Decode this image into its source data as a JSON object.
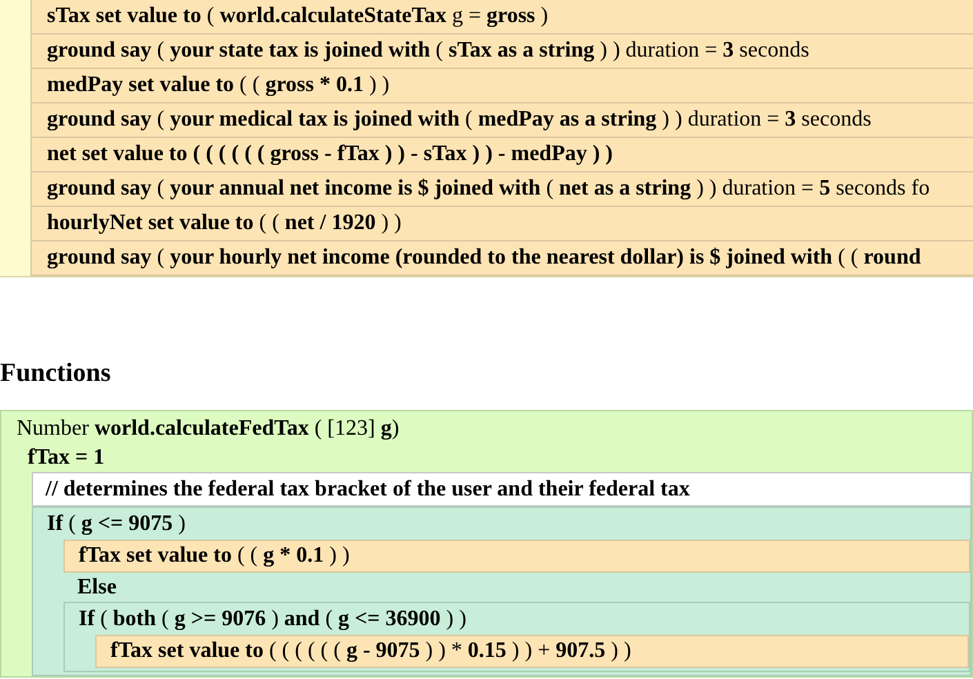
{
  "main_block": {
    "lines": [
      "**sTax set value to** ( **world.calculateStateTax** g = **gross** )",
      "**ground say** ( **your state tax is joined with** ( **sTax as a string** ) ) duration = **3** seconds",
      "**medPay set value to** ( ( **gross * 0.1** ) )",
      "**ground say** ( **your medical tax is joined with** ( **medPay as a string** ) ) duration = **3** seconds",
      "**net set value to ( ( ( ( ( ( gross - fTax ) ) - sTax ) ) - medPay ) )**",
      "**ground say** ( **your annual net income is $ joined with** ( **net as a string** ) ) duration = **5** seconds fo",
      "**hourlyNet set value to** ( ( **net / 1920** ) )",
      "**ground say** ( **your hourly net income (rounded to the nearest dollar) is $ joined with** ( ( **round**"
    ]
  },
  "functions": {
    "heading": "Functions",
    "function": {
      "signature": "Number **world.calculateFedTax** ( [123] **g**)",
      "children": [
        {
          "kind": "text",
          "text": "**fTax = 1**"
        },
        {
          "kind": "comment",
          "text": "**// determines the federal tax bracket of the user and their federal tax**"
        },
        {
          "kind": "if",
          "text": "**If** ( **g <= 9075** )",
          "children": [
            {
              "kind": "statement",
              "text": "**fTax set value to** ( ( **g * 0.1** ) )"
            },
            {
              "kind": "text",
              "text": "**Else**"
            },
            {
              "kind": "if",
              "text": "**If** ( **both** ( **g >= 9076** ) **and** ( **g <= 36900** ) )",
              "children": [
                {
                  "kind": "statement",
                  "text": "**fTax set value to** ( ( ( ( ( ( **g - 9075** ) ) * **0.15** ) ) + **907.5** ) )"
                }
              ]
            }
          ]
        }
      ]
    }
  }
}
